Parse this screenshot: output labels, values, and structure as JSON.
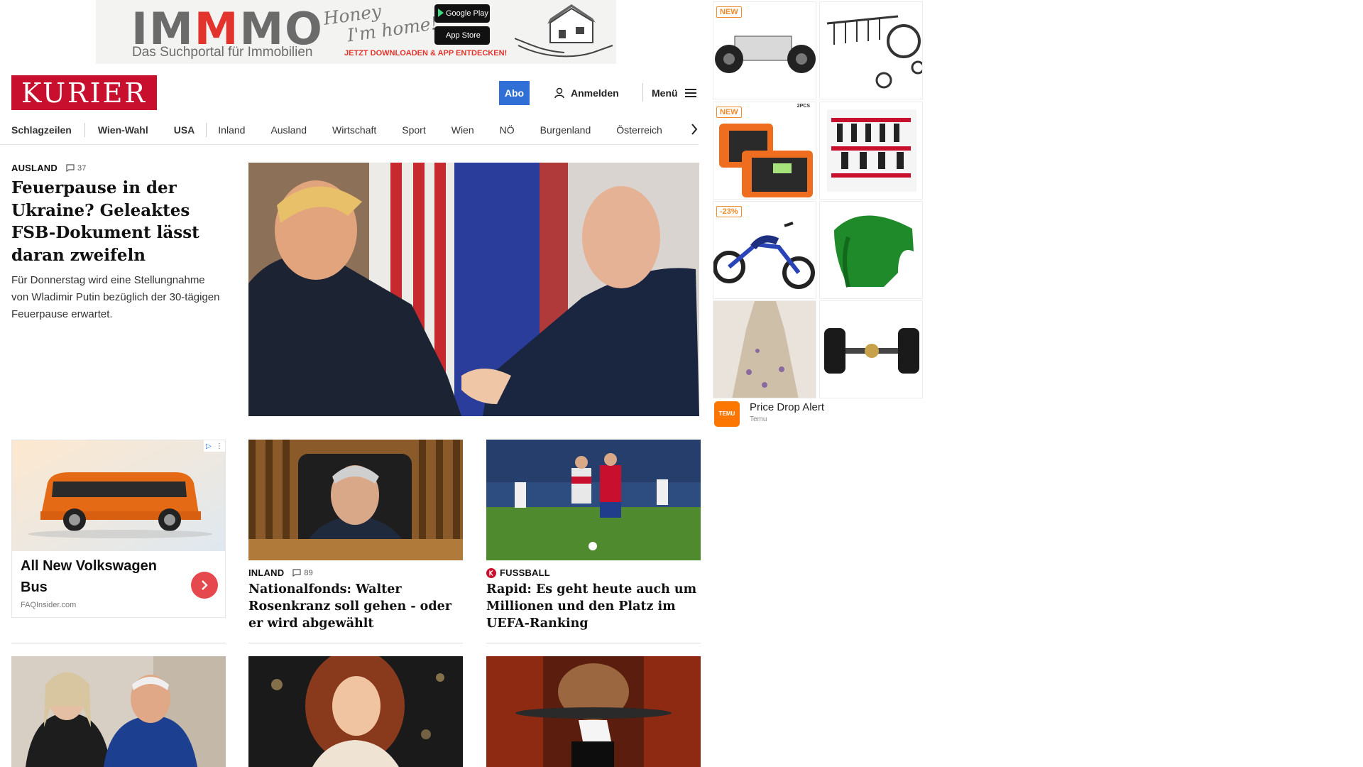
{
  "banner_ad": {
    "logo_left": "IM",
    "logo_mid": "M",
    "logo_right": "MO",
    "tagline": "Das Suchportal für Immobilien",
    "script_line1": "Honey",
    "script_line2": "I'm home!",
    "google_play": "Google Play",
    "app_store": "App Store",
    "cta": "JETZT DOWNLOADEN & APP ENTDECKEN!"
  },
  "header": {
    "logo": "KURIER",
    "abo": "Abo",
    "login": "Anmelden",
    "menu": "Menü"
  },
  "nav": {
    "items": [
      "Schlagzeilen",
      "Wien-Wahl",
      "USA",
      "Inland",
      "Ausland",
      "Wirtschaft",
      "Sport",
      "Wien",
      "NÖ",
      "Burgenland",
      "Österreich"
    ]
  },
  "lead": {
    "kicker": "AUSLAND",
    "comments": "37",
    "headline": "Feuerpause in der Ukraine? Geleaktes FSB-Dokument lässt daran zweifeln",
    "teaser": "Für Donnerstag wird eine Stellungnahme von Wladimir Putin bezüglich der 30-tägigen Feuerpause erwartet."
  },
  "vw_ad": {
    "title": "All New Volkswagen Bus",
    "source": "FAQInsider.com"
  },
  "cards": [
    {
      "kicker": "INLAND",
      "comments": "89",
      "title": "Nationalfonds: Walter Rosenkranz soll gehen - oder er wird abgewählt"
    },
    {
      "kicker": "FUSSBALL",
      "title": "Rapid: Es geht heute auch um Millionen und den Platz im UEFA-Ranking"
    }
  ],
  "side_ad": {
    "badges": [
      "NEW",
      "NEW",
      "-23%"
    ],
    "pcs_label": "2PCS",
    "price_drop_title": "Price Drop Alert",
    "price_drop_source": "Temu",
    "temu_logo": "TEMU"
  },
  "colors": {
    "brand_red": "#c8102e",
    "abo_blue": "#2f6fd6",
    "badge_orange": "#f28c28"
  }
}
